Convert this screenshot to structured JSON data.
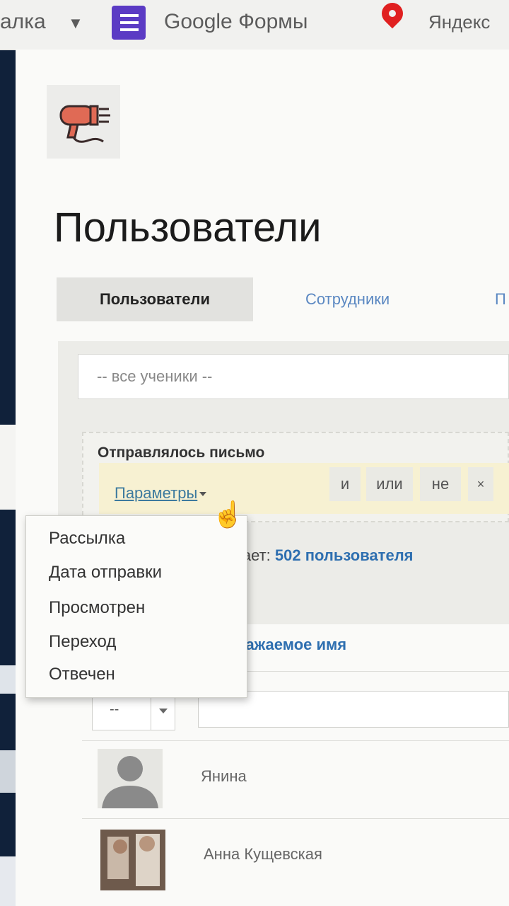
{
  "bookmarks": {
    "item1_label": "алка",
    "item2_label": "Google Формы",
    "item3_label": "Яндекс"
  },
  "page": {
    "title": "Пользователи"
  },
  "tabs": [
    {
      "label": "Пользователи",
      "active": true
    },
    {
      "label": "Сотрудники",
      "active": false
    },
    {
      "label": "П",
      "active": false
    }
  ],
  "filter": {
    "select_value": "-- все ученики --",
    "condition_title": "Отправлялось письмо",
    "params_label": "Параметры",
    "ops": [
      "и",
      "или",
      "не",
      "×"
    ]
  },
  "results": {
    "prefix": "дает:",
    "count_text": "502 пользователя"
  },
  "table": {
    "column_header": "ражаемое имя",
    "type_select_value": "--"
  },
  "users": [
    {
      "name": "Янина"
    },
    {
      "name": "Анна Кущевская"
    }
  ],
  "dropdown": {
    "items": [
      "Рассылка",
      "Дата отправки",
      "Просмотрен",
      "Переход",
      "Отвечен"
    ]
  },
  "colors": {
    "link": "#2e6fb0",
    "condition_bg": "#f7f1d2",
    "forms_icon": "#5b3bc4",
    "maps_pin": "#e02020"
  }
}
